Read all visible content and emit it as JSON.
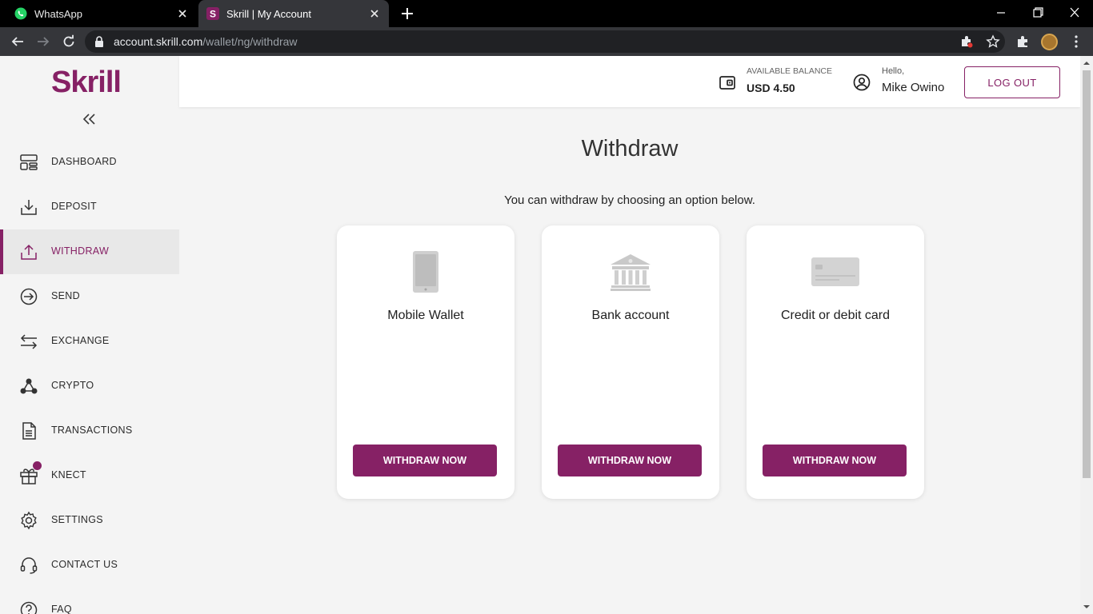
{
  "browser": {
    "tabs": [
      {
        "title": "WhatsApp",
        "active": false
      },
      {
        "title": "Skrill | My Account",
        "active": true
      }
    ],
    "url_host": "account.skrill.com",
    "url_path": "/wallet/ng/withdraw"
  },
  "sidebar": {
    "logo": "Skrill",
    "items": [
      {
        "label": "DASHBOARD",
        "icon": "dashboard-icon",
        "active": false
      },
      {
        "label": "DEPOSIT",
        "icon": "deposit-icon",
        "active": false
      },
      {
        "label": "WITHDRAW",
        "icon": "withdraw-icon",
        "active": true
      },
      {
        "label": "SEND",
        "icon": "send-icon",
        "active": false
      },
      {
        "label": "EXCHANGE",
        "icon": "exchange-icon",
        "active": false
      },
      {
        "label": "CRYPTO",
        "icon": "crypto-icon",
        "active": false
      },
      {
        "label": "TRANSACTIONS",
        "icon": "transactions-icon",
        "active": false
      },
      {
        "label": "KNECT",
        "icon": "gift-icon",
        "active": false,
        "badge": true
      },
      {
        "label": "SETTINGS",
        "icon": "gear-icon",
        "active": false
      },
      {
        "label": "CONTACT US",
        "icon": "headset-icon",
        "active": false
      },
      {
        "label": "FAQ",
        "icon": "help-icon",
        "active": false
      }
    ]
  },
  "header": {
    "balance_label": "AVAILABLE BALANCE",
    "balance_value": "USD 4.50",
    "greeting": "Hello,",
    "user_name": "Mike Owino",
    "logout_label": "LOG OUT"
  },
  "main": {
    "title": "Withdraw",
    "subtitle": "You can withdraw by choosing an option below.",
    "options": [
      {
        "title": "Mobile Wallet",
        "icon": "mobile-phone-icon",
        "button": "WITHDRAW NOW"
      },
      {
        "title": "Bank account",
        "icon": "bank-icon",
        "button": "WITHDRAW NOW"
      },
      {
        "title": "Credit or debit card",
        "icon": "credit-card-icon",
        "button": "WITHDRAW NOW"
      }
    ]
  },
  "colors": {
    "brand": "#862165",
    "page_bg": "#f4f4f4",
    "card_bg": "#ffffff"
  }
}
